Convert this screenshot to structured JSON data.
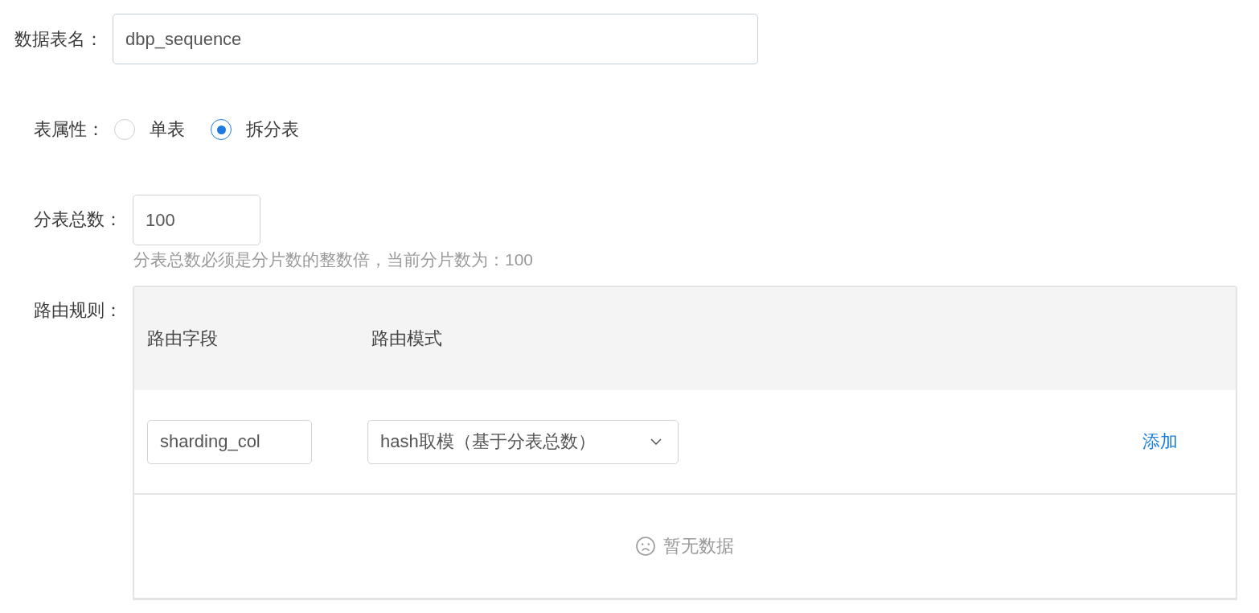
{
  "table_name": {
    "label": "数据表名：",
    "value": "dbp_sequence"
  },
  "table_type": {
    "label": "表属性：",
    "options": [
      {
        "label": "单表",
        "selected": false
      },
      {
        "label": "拆分表",
        "selected": true
      }
    ]
  },
  "shard_count": {
    "label": "分表总数：",
    "value": "100",
    "hint": "分表总数必须是分片数的整数倍，当前分片数为：100"
  },
  "routing_rules": {
    "label": "路由规则：",
    "columns": [
      "路由字段",
      "路由模式"
    ],
    "new_rule": {
      "field": "sharding_col",
      "mode": "hash取模（基于分表总数）",
      "add_link": "添加"
    },
    "empty_text": "暂无数据"
  }
}
